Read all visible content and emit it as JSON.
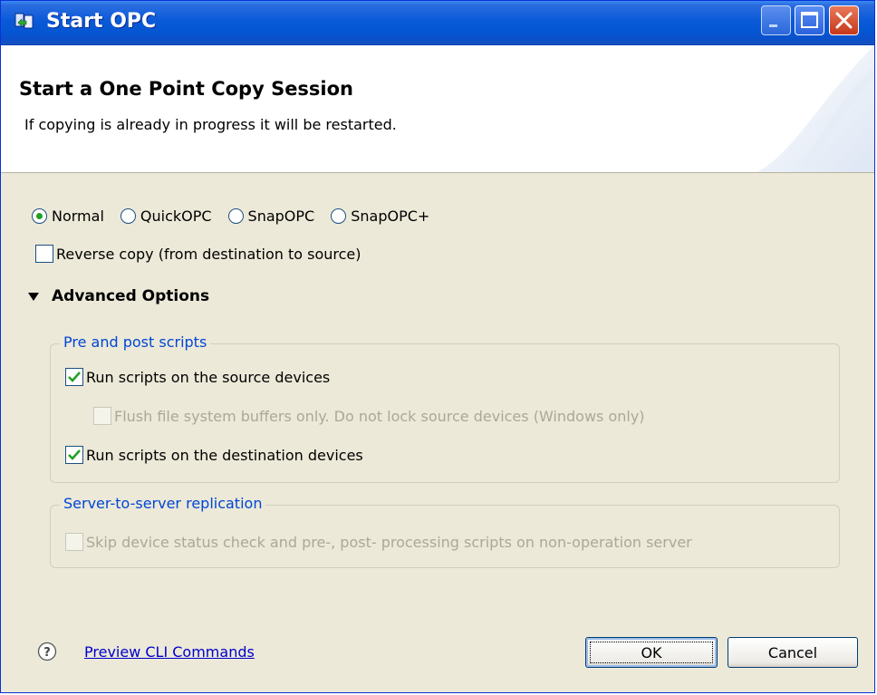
{
  "window": {
    "title": "Start OPC",
    "controls": [
      "minimize",
      "maximize",
      "close"
    ]
  },
  "header": {
    "title": "Start a One Point Copy Session",
    "description": "If copying is already in progress it will be restarted."
  },
  "mode": {
    "options": [
      "Normal",
      "QuickOPC",
      "SnapOPC",
      "SnapOPC+"
    ],
    "selected": "Normal"
  },
  "reverse_copy": {
    "label": "Reverse copy (from destination to source)",
    "checked": false
  },
  "advanced": {
    "label": "Advanced Options",
    "expanded": true,
    "pre_post_group": {
      "label": "Pre and post scripts",
      "run_source": {
        "label": "Run scripts on the source devices",
        "checked": true
      },
      "flush_only": {
        "label": "Flush file system buffers only. Do not lock source devices (Windows only)",
        "checked": false,
        "enabled": false
      },
      "run_destination": {
        "label": "Run scripts on the destination devices",
        "checked": true
      }
    },
    "replication_group": {
      "label": "Server-to-server replication",
      "skip_check": {
        "label": "Skip device status check and pre-, post- processing scripts on non-operation server",
        "checked": false,
        "enabled": false
      }
    }
  },
  "footer": {
    "help_icon": "help-icon",
    "preview_link": "Preview CLI Commands",
    "ok_label": "OK",
    "cancel_label": "Cancel"
  },
  "colors": {
    "titlebar": "#0a5ad8",
    "dialog_bg": "#ece9d8",
    "group_label": "#0046d5",
    "link": "#0000cc",
    "check_green": "#21a121"
  }
}
